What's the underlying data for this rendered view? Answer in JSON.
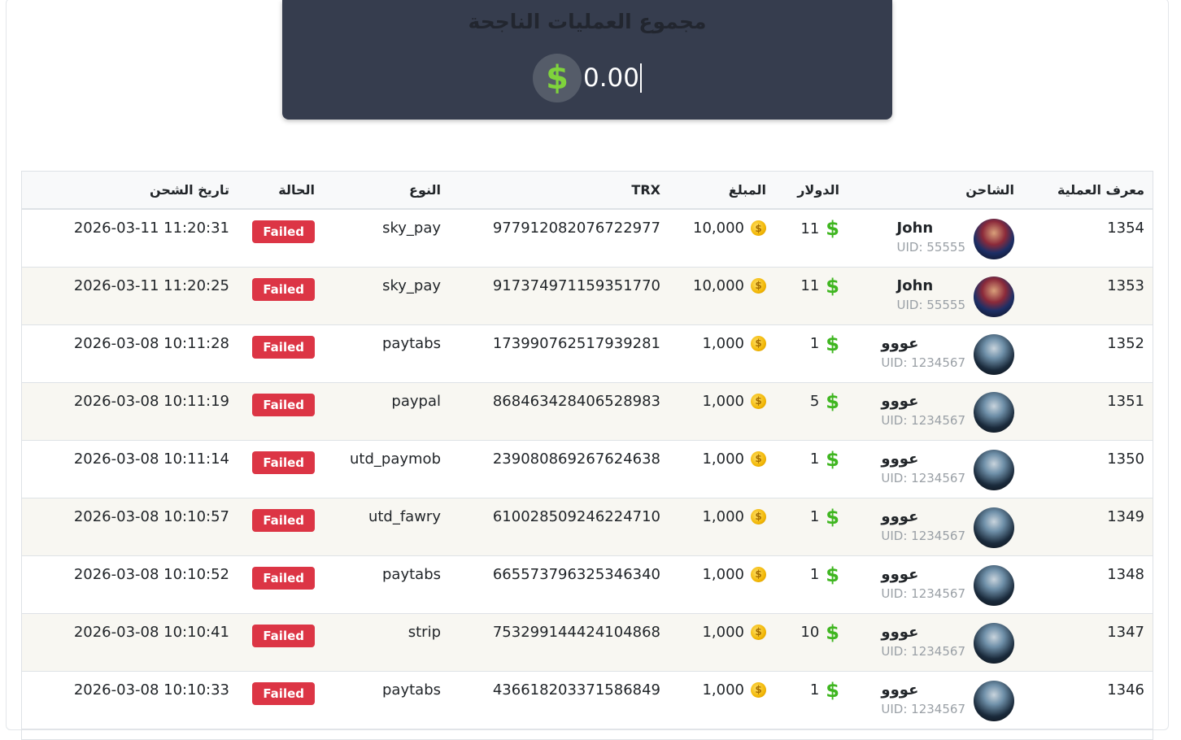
{
  "summary": {
    "title": "مجموع العمليات الناجحة",
    "currency_icon": "dollar-icon",
    "amount": "0.00"
  },
  "table": {
    "headers": {
      "id": "معرف العملية",
      "charger": "الشاحن",
      "dollar": "الدولار",
      "amount": "المبلغ",
      "trx": "TRX",
      "type": "النوع",
      "status": "الحالة",
      "date": "تاريخ الشحن"
    },
    "rows": [
      {
        "id": "1354",
        "name": "John",
        "uid": "UID: 55555",
        "dollar": "11",
        "amount": "10,000",
        "trx": "977912082076722977",
        "type": "sky_pay",
        "status": "Failed",
        "date": "2026-03-11 11:20:31"
      },
      {
        "id": "1353",
        "name": "John",
        "uid": "UID: 55555",
        "dollar": "11",
        "amount": "10,000",
        "trx": "917374971159351770",
        "type": "sky_pay",
        "status": "Failed",
        "date": "2026-03-11 11:20:25"
      },
      {
        "id": "1352",
        "name": "عووو",
        "uid": "UID: 1234567",
        "dollar": "1",
        "amount": "1,000",
        "trx": "173990762517939281",
        "type": "paytabs",
        "status": "Failed",
        "date": "2026-03-08 10:11:28"
      },
      {
        "id": "1351",
        "name": "عووو",
        "uid": "UID: 1234567",
        "dollar": "5",
        "amount": "1,000",
        "trx": "868463428406528983",
        "type": "paypal",
        "status": "Failed",
        "date": "2026-03-08 10:11:19"
      },
      {
        "id": "1350",
        "name": "عووو",
        "uid": "UID: 1234567",
        "dollar": "1",
        "amount": "1,000",
        "trx": "239080869267624638",
        "type": "utd_paymob",
        "status": "Failed",
        "date": "2026-03-08 10:11:14"
      },
      {
        "id": "1349",
        "name": "عووو",
        "uid": "UID: 1234567",
        "dollar": "1",
        "amount": "1,000",
        "trx": "610028509246224710",
        "type": "utd_fawry",
        "status": "Failed",
        "date": "2026-03-08 10:10:57"
      },
      {
        "id": "1348",
        "name": "عووو",
        "uid": "UID: 1234567",
        "dollar": "1",
        "amount": "1,000",
        "trx": "665573796325346340",
        "type": "paytabs",
        "status": "Failed",
        "date": "2026-03-08 10:10:52"
      },
      {
        "id": "1347",
        "name": "عووو",
        "uid": "UID: 1234567",
        "dollar": "10",
        "amount": "1,000",
        "trx": "753299144424104868",
        "type": "strip",
        "status": "Failed",
        "date": "2026-03-08 10:10:41"
      },
      {
        "id": "1346",
        "name": "عووو",
        "uid": "UID: 1234567",
        "dollar": "1",
        "amount": "1,000",
        "trx": "436618203371586849",
        "type": "paytabs",
        "status": "Failed",
        "date": "2026-03-08 10:10:33"
      }
    ]
  },
  "colors": {
    "card_bg": "#363d4e",
    "dollar_green": "#3fb620",
    "failed_red": "#dc3545"
  }
}
